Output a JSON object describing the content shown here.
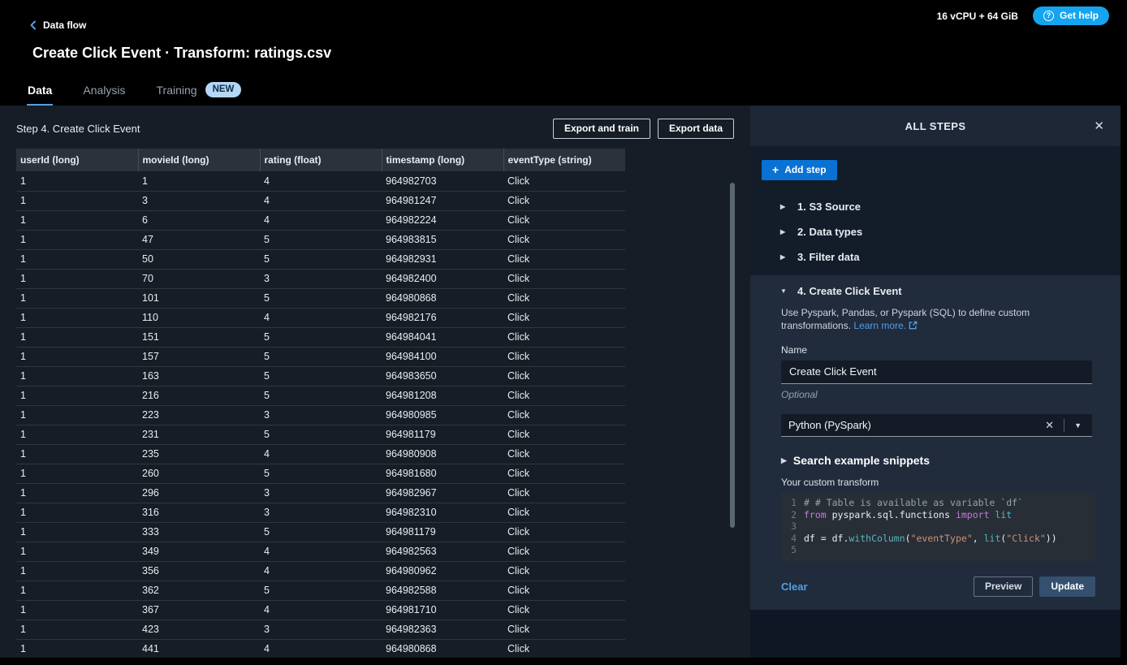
{
  "topbar": {
    "breadcrumb": "Data flow",
    "instance_info": "16 vCPU + 64 GiB",
    "get_help_label": "Get help"
  },
  "header": {
    "title": "Create Click Event · Transform: ratings.csv",
    "tabs": [
      {
        "label": "Data",
        "active": true
      },
      {
        "label": "Analysis",
        "active": false
      },
      {
        "label": "Training",
        "active": false,
        "badge": "NEW"
      }
    ]
  },
  "left": {
    "step_label": "Step 4. Create Click Event",
    "export_train_label": "Export and train",
    "export_data_label": "Export data",
    "table": {
      "columns": [
        "userId (long)",
        "movieId (long)",
        "rating (float)",
        "timestamp (long)",
        "eventType (string)"
      ],
      "rows": [
        [
          "1",
          "1",
          "4",
          "964982703",
          "Click"
        ],
        [
          "1",
          "3",
          "4",
          "964981247",
          "Click"
        ],
        [
          "1",
          "6",
          "4",
          "964982224",
          "Click"
        ],
        [
          "1",
          "47",
          "5",
          "964983815",
          "Click"
        ],
        [
          "1",
          "50",
          "5",
          "964982931",
          "Click"
        ],
        [
          "1",
          "70",
          "3",
          "964982400",
          "Click"
        ],
        [
          "1",
          "101",
          "5",
          "964980868",
          "Click"
        ],
        [
          "1",
          "110",
          "4",
          "964982176",
          "Click"
        ],
        [
          "1",
          "151",
          "5",
          "964984041",
          "Click"
        ],
        [
          "1",
          "157",
          "5",
          "964984100",
          "Click"
        ],
        [
          "1",
          "163",
          "5",
          "964983650",
          "Click"
        ],
        [
          "1",
          "216",
          "5",
          "964981208",
          "Click"
        ],
        [
          "1",
          "223",
          "3",
          "964980985",
          "Click"
        ],
        [
          "1",
          "231",
          "5",
          "964981179",
          "Click"
        ],
        [
          "1",
          "235",
          "4",
          "964980908",
          "Click"
        ],
        [
          "1",
          "260",
          "5",
          "964981680",
          "Click"
        ],
        [
          "1",
          "296",
          "3",
          "964982967",
          "Click"
        ],
        [
          "1",
          "316",
          "3",
          "964982310",
          "Click"
        ],
        [
          "1",
          "333",
          "5",
          "964981179",
          "Click"
        ],
        [
          "1",
          "349",
          "4",
          "964982563",
          "Click"
        ],
        [
          "1",
          "356",
          "4",
          "964980962",
          "Click"
        ],
        [
          "1",
          "362",
          "5",
          "964982588",
          "Click"
        ],
        [
          "1",
          "367",
          "4",
          "964981710",
          "Click"
        ],
        [
          "1",
          "423",
          "3",
          "964982363",
          "Click"
        ],
        [
          "1",
          "441",
          "4",
          "964980868",
          "Click"
        ]
      ]
    }
  },
  "panel": {
    "title": "ALL STEPS",
    "add_step_label": "Add step",
    "collapsed_steps": [
      {
        "label": "1. S3 Source"
      },
      {
        "label": "2. Data types"
      },
      {
        "label": "3. Filter data"
      }
    ],
    "active_step": {
      "label": "4. Create Click Event",
      "description": "Use Pyspark, Pandas, or Pyspark (SQL) to define custom transformations.",
      "learn_more_label": "Learn more.",
      "name_label": "Name",
      "name_value": "Create Click Event",
      "optional_label": "Optional",
      "language_value": "Python (PySpark)",
      "snippets_label": "Search example snippets",
      "transform_label": "Your custom transform",
      "code_lines": [
        [
          {
            "t": "# # Table is available as variable `df`",
            "c": "comment"
          }
        ],
        [
          {
            "t": "from",
            "c": "kw"
          },
          {
            "t": " pyspark.sql.functions ",
            "c": "plain"
          },
          {
            "t": "import",
            "c": "kw"
          },
          {
            "t": " lit",
            "c": "fn"
          }
        ],
        [],
        [
          {
            "t": "df = df.",
            "c": "plain"
          },
          {
            "t": "withColumn",
            "c": "fn"
          },
          {
            "t": "(",
            "c": "plain"
          },
          {
            "t": "\"eventType\"",
            "c": "str"
          },
          {
            "t": ", ",
            "c": "plain"
          },
          {
            "t": "lit",
            "c": "fn"
          },
          {
            "t": "(",
            "c": "plain"
          },
          {
            "t": "\"Click\"",
            "c": "str"
          },
          {
            "t": "))",
            "c": "plain"
          }
        ],
        []
      ],
      "clear_label": "Clear",
      "preview_label": "Preview",
      "update_label": "Update"
    }
  },
  "icons": {
    "help_circle": "?",
    "close": "✕",
    "caret_collapsed": "▶",
    "caret_expanded": "▼",
    "clear_x": "✕",
    "caret_down": "▼",
    "plus": "+"
  },
  "colors": {
    "accent_blue": "#0972d3",
    "help_button_blue": "#14a4f0",
    "link_blue": "#539fe5",
    "tab_underline": "#539fe5",
    "new_badge_bg": "#b5d6f7",
    "new_badge_text": "#0d2b45",
    "code_comment": "#93a1ae",
    "code_keyword": "#c678dd",
    "code_function": "#56b6c2",
    "code_string": "#ce9178"
  }
}
